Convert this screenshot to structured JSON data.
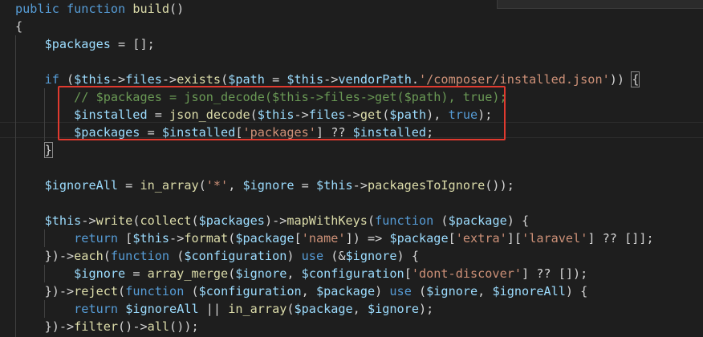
{
  "lines": [
    [
      [
        "kw",
        "public "
      ],
      [
        "kw",
        "function "
      ],
      [
        "fn",
        "build"
      ],
      [
        "pun",
        "()"
      ]
    ],
    [
      [
        "pun",
        "{"
      ]
    ],
    [
      [
        "pun",
        "    "
      ],
      [
        "var",
        "$packages"
      ],
      [
        "pun",
        " = [];"
      ]
    ],
    [
      [
        "pun",
        ""
      ]
    ],
    [
      [
        "pun",
        "    "
      ],
      [
        "kw",
        "if"
      ],
      [
        "pun",
        " ("
      ],
      [
        "var",
        "$this"
      ],
      [
        "pun",
        "->"
      ],
      [
        "var",
        "files"
      ],
      [
        "pun",
        "->"
      ],
      [
        "fn",
        "exists"
      ],
      [
        "pun",
        "("
      ],
      [
        "var",
        "$path"
      ],
      [
        "pun",
        " = "
      ],
      [
        "var",
        "$this"
      ],
      [
        "pun",
        "->"
      ],
      [
        "var",
        "vendorPath"
      ],
      [
        "pun",
        "."
      ],
      [
        "str",
        "'/composer/installed.json'"
      ],
      [
        "pun",
        "))"
      ],
      [
        "pun",
        " "
      ],
      [
        "pun",
        "{"
      ]
    ],
    [
      [
        "pun",
        "        "
      ],
      [
        "cm",
        "// $packages = json_decode($this->files->get($path), true);"
      ]
    ],
    [
      [
        "pun",
        "        "
      ],
      [
        "var",
        "$installed"
      ],
      [
        "pun",
        " = "
      ],
      [
        "fn",
        "json_decode"
      ],
      [
        "pun",
        "("
      ],
      [
        "var",
        "$this"
      ],
      [
        "pun",
        "->"
      ],
      [
        "var",
        "files"
      ],
      [
        "pun",
        "->"
      ],
      [
        "fn",
        "get"
      ],
      [
        "pun",
        "("
      ],
      [
        "var",
        "$path"
      ],
      [
        "pun",
        "), "
      ],
      [
        "kw",
        "true"
      ],
      [
        "pun",
        ");"
      ]
    ],
    [
      [
        "pun",
        "        "
      ],
      [
        "var",
        "$packages"
      ],
      [
        "pun",
        " = "
      ],
      [
        "var",
        "$installed"
      ],
      [
        "pun",
        "["
      ],
      [
        "str",
        "'packages'"
      ],
      [
        "pun",
        "] ?? "
      ],
      [
        "var",
        "$installed"
      ],
      [
        "pun",
        ";"
      ]
    ],
    [
      [
        "pun",
        "    "
      ],
      [
        "pun",
        "}"
      ]
    ],
    [
      [
        "pun",
        ""
      ]
    ],
    [
      [
        "pun",
        "    "
      ],
      [
        "var",
        "$ignoreAll"
      ],
      [
        "pun",
        " = "
      ],
      [
        "fn",
        "in_array"
      ],
      [
        "pun",
        "("
      ],
      [
        "str",
        "'*'"
      ],
      [
        "pun",
        ", "
      ],
      [
        "var",
        "$ignore"
      ],
      [
        "pun",
        " = "
      ],
      [
        "var",
        "$this"
      ],
      [
        "pun",
        "->"
      ],
      [
        "fn",
        "packagesToIgnore"
      ],
      [
        "pun",
        "());"
      ]
    ],
    [
      [
        "pun",
        ""
      ]
    ],
    [
      [
        "pun",
        "    "
      ],
      [
        "var",
        "$this"
      ],
      [
        "pun",
        "->"
      ],
      [
        "fn",
        "write"
      ],
      [
        "pun",
        "("
      ],
      [
        "fn",
        "collect"
      ],
      [
        "pun",
        "("
      ],
      [
        "var",
        "$packages"
      ],
      [
        "pun",
        ")->"
      ],
      [
        "fn",
        "mapWithKeys"
      ],
      [
        "pun",
        "("
      ],
      [
        "kw",
        "function"
      ],
      [
        "pun",
        " ("
      ],
      [
        "var",
        "$package"
      ],
      [
        "pun",
        ") {"
      ]
    ],
    [
      [
        "pun",
        "        "
      ],
      [
        "kw",
        "return"
      ],
      [
        "pun",
        " ["
      ],
      [
        "var",
        "$this"
      ],
      [
        "pun",
        "->"
      ],
      [
        "fn",
        "format"
      ],
      [
        "pun",
        "("
      ],
      [
        "var",
        "$package"
      ],
      [
        "pun",
        "["
      ],
      [
        "str",
        "'name'"
      ],
      [
        "pun",
        "]) => "
      ],
      [
        "var",
        "$package"
      ],
      [
        "pun",
        "["
      ],
      [
        "str",
        "'extra'"
      ],
      [
        "pun",
        "]["
      ],
      [
        "str",
        "'laravel'"
      ],
      [
        "pun",
        "] ?? []];"
      ]
    ],
    [
      [
        "pun",
        "    })->"
      ],
      [
        "fn",
        "each"
      ],
      [
        "pun",
        "("
      ],
      [
        "kw",
        "function"
      ],
      [
        "pun",
        " ("
      ],
      [
        "var",
        "$configuration"
      ],
      [
        "pun",
        ") "
      ],
      [
        "kw",
        "use"
      ],
      [
        "pun",
        " (&"
      ],
      [
        "var",
        "$ignore"
      ],
      [
        "pun",
        ") {"
      ]
    ],
    [
      [
        "pun",
        "        "
      ],
      [
        "var",
        "$ignore"
      ],
      [
        "pun",
        " = "
      ],
      [
        "fn",
        "array_merge"
      ],
      [
        "pun",
        "("
      ],
      [
        "var",
        "$ignore"
      ],
      [
        "pun",
        ", "
      ],
      [
        "var",
        "$configuration"
      ],
      [
        "pun",
        "["
      ],
      [
        "str",
        "'dont-discover'"
      ],
      [
        "pun",
        "] ?? []);"
      ]
    ],
    [
      [
        "pun",
        "    })->"
      ],
      [
        "fn",
        "reject"
      ],
      [
        "pun",
        "("
      ],
      [
        "kw",
        "function"
      ],
      [
        "pun",
        " ("
      ],
      [
        "var",
        "$configuration"
      ],
      [
        "pun",
        ", "
      ],
      [
        "var",
        "$package"
      ],
      [
        "pun",
        ") "
      ],
      [
        "kw",
        "use"
      ],
      [
        "pun",
        " ("
      ],
      [
        "var",
        "$ignore"
      ],
      [
        "pun",
        ", "
      ],
      [
        "var",
        "$ignoreAll"
      ],
      [
        "pun",
        ") {"
      ]
    ],
    [
      [
        "pun",
        "        "
      ],
      [
        "kw",
        "return"
      ],
      [
        "pun",
        " "
      ],
      [
        "var",
        "$ignoreAll"
      ],
      [
        "pun",
        " || "
      ],
      [
        "fn",
        "in_array"
      ],
      [
        "pun",
        "("
      ],
      [
        "var",
        "$package"
      ],
      [
        "pun",
        ", "
      ],
      [
        "var",
        "$ignore"
      ],
      [
        "pun",
        ");"
      ]
    ],
    [
      [
        "pun",
        "    })->"
      ],
      [
        "fn",
        "filter"
      ],
      [
        "pun",
        "()->"
      ],
      [
        "fn",
        "all"
      ],
      [
        "pun",
        "());"
      ]
    ],
    [
      [
        "pun",
        "}"
      ]
    ]
  ]
}
